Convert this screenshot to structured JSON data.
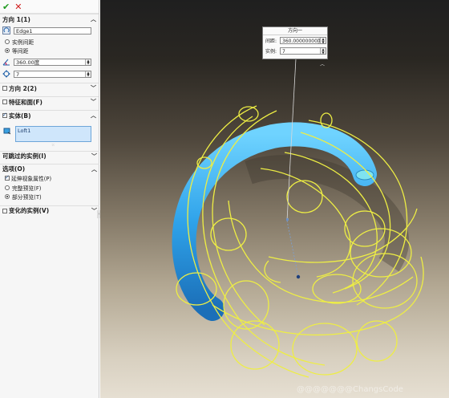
{
  "toolbar": {
    "ok_glyph": "✔",
    "cancel_glyph": "✕"
  },
  "dir1": {
    "header": "方向 1(1)",
    "edge_value": "Edge1",
    "opt_spacing": "实例间距",
    "opt_equal": "等间距",
    "angle_value": "360.00度",
    "count_value": "7"
  },
  "dir2": {
    "header": "方向 2(2)"
  },
  "features": {
    "header": "特征和面(F)"
  },
  "bodies": {
    "header": "实体(B)",
    "list_item": "Loft1"
  },
  "skipped": {
    "header": "可跳过的实例(I)"
  },
  "options": {
    "header": "选项(O)",
    "propagate": "延伸视象属性(P)",
    "full_preview": "完整预览(F)",
    "partial_preview": "部分预览(T)"
  },
  "varied": {
    "header": "变化的实例(V)"
  },
  "popup": {
    "title": "方向一",
    "spacing_label": "间距:",
    "spacing_value": "360.00000000度",
    "count_label": "实例:",
    "count_value": "7"
  },
  "watermark": "@@@@@@@ChangsCode",
  "colors": {
    "body": "#2fa3ea",
    "outline": "#eeee44",
    "check": "#1f9a1f",
    "cancel": "#d01a1a"
  }
}
